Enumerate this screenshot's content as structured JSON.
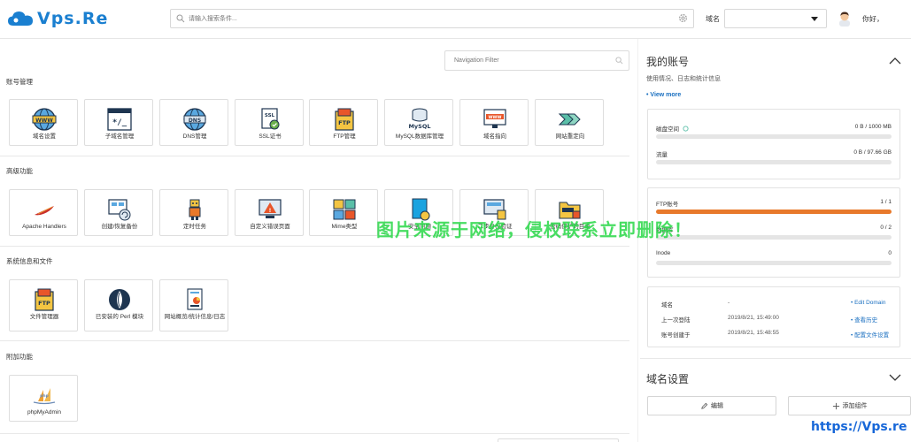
{
  "header": {
    "logo_text": "Vps.Re",
    "search_placeholder": "请输入搜索条件...",
    "domain_label": "域名",
    "domain_value": "",
    "user_greeting": "你好，"
  },
  "nav_filter": {
    "placeholder": "Navigation Filter"
  },
  "sections": {
    "account": {
      "title": "账号管理",
      "items": [
        "域名设置",
        "子域名管理",
        "DNS管理",
        "SSL证书",
        "FTP管理",
        "MySQL数据库管理",
        "域名指向",
        "网站重定向"
      ]
    },
    "advanced": {
      "title": "高级功能",
      "items": [
        "Apache Handlers",
        "创建/恢复备份",
        "定时任务",
        "自定义错误页面",
        "Mime类型",
        "安全问题",
        "二步身份验证",
        "密码保护的目录"
      ]
    },
    "system": {
      "title": "系统信息和文件",
      "items": [
        "文件管理器",
        "已安装的 Perl 模块",
        "网站概览/统计信息/日志"
      ]
    },
    "extra": {
      "title": "附加功能",
      "items": [
        "phpMyAdmin"
      ]
    }
  },
  "account_panel": {
    "title": "我的账号",
    "subtitle": "使用情况、日志和统计信息",
    "view_more": "• View more",
    "usage": [
      {
        "label": "磁盘空间",
        "value": "0 B / 1000 MB",
        "fraction": 0
      },
      {
        "label": "流量",
        "value": "0 B / 97.66 GB",
        "fraction": 0
      }
    ],
    "counts": [
      {
        "label": "FTP账号",
        "value": "1 / 1",
        "fraction": 1
      },
      {
        "label": "数据库",
        "value": "0 / 2",
        "fraction": 0
      },
      {
        "label": "Inode",
        "value": "0",
        "fraction": 0
      }
    ],
    "info": [
      {
        "key": "域名",
        "value": "-",
        "link": "• Edit Domain"
      },
      {
        "key": "上一次登陆",
        "value": "2019/8/21, 15:49:00",
        "link": "• 查看历史"
      },
      {
        "key": "账号创建于",
        "value": "2019/8/21, 15:48:55",
        "link": "• 配置文件设置"
      }
    ]
  },
  "domain_panel": {
    "title": "域名设置",
    "edit_button": "编辑",
    "add_button": "添加组件"
  },
  "watermark": "图片来源于网络，侵权联系立即删除！",
  "site_mark": "https://Vps.re",
  "colors": {
    "brand": "#1a7fd0",
    "progress": "#e8792b",
    "link": "#1a6fc0"
  }
}
